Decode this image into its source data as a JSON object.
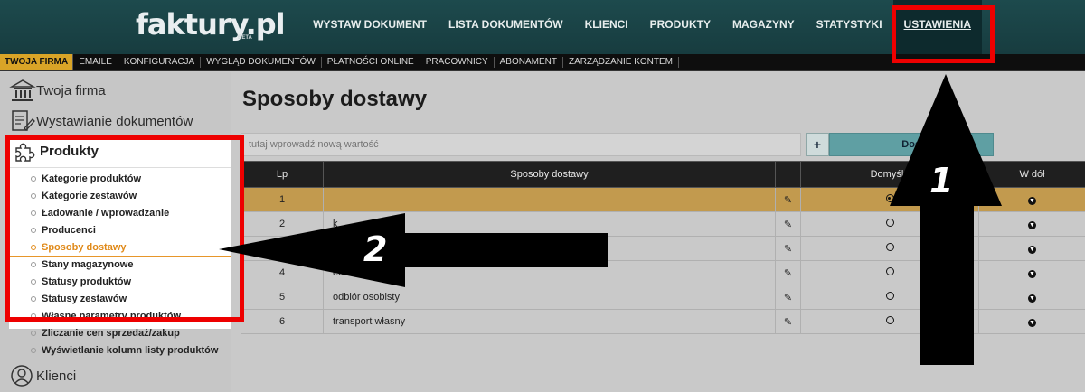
{
  "header": {
    "logo": "faktury.pl",
    "logo_badge": "BETA",
    "nav": [
      "WYSTAW DOKUMENT",
      "LISTA DOKUMENTÓW",
      "KLIENCI",
      "PRODUKTY",
      "MAGAZYNY",
      "STATYSTYKI",
      "USTAWIENIA"
    ],
    "active_nav": "USTAWIENIA"
  },
  "subnav": [
    "TWOJA FIRMA",
    "EMAILE",
    "KONFIGURACJA",
    "WYGLĄD DOKUMENTÓW",
    "PŁATNOŚCI ONLINE",
    "PRACOWNICY",
    "ABONAMENT",
    "ZARZĄDZANIE KONTEM"
  ],
  "sidebar": {
    "sections": [
      "Twoja firma",
      "Wystawianie dokumentów",
      "Produkty",
      "Klienci"
    ],
    "active_section": "Produkty",
    "items": [
      "Kategorie produktów",
      "Kategorie zestawów",
      "Ładowanie / wprowadzanie",
      "Producenci",
      "Sposoby dostawy",
      "Stany magazynowe",
      "Statusy produktów",
      "Statusy zestawów",
      "Własne parametry produktów",
      "Zliczanie cen sprzedaż/zakup",
      "Wyświetlanie kolumn listy produktów"
    ],
    "current_item": "Sposoby dostawy"
  },
  "main": {
    "title": "Sposoby dostawy",
    "input_placeholder": "tutaj wprowadź nową wartość",
    "plus": "+",
    "add_label": "Dod",
    "table": {
      "headers": [
        "Lp",
        "Sposoby dostawy",
        "",
        "Domyśln",
        "W dół"
      ],
      "rows": [
        {
          "lp": "1",
          "name": "",
          "default": true
        },
        {
          "lp": "2",
          "name": "k",
          "default": false
        },
        {
          "lp": "3",
          "name": "",
          "default": false
        },
        {
          "lp": "4",
          "name": "em",
          "default": false
        },
        {
          "lp": "5",
          "name": "odbiór osobisty",
          "default": false
        },
        {
          "lp": "6",
          "name": "transport własny",
          "default": false
        }
      ]
    }
  },
  "annotations": {
    "label1": "1",
    "label2": "2",
    "color": "#ee0000"
  }
}
